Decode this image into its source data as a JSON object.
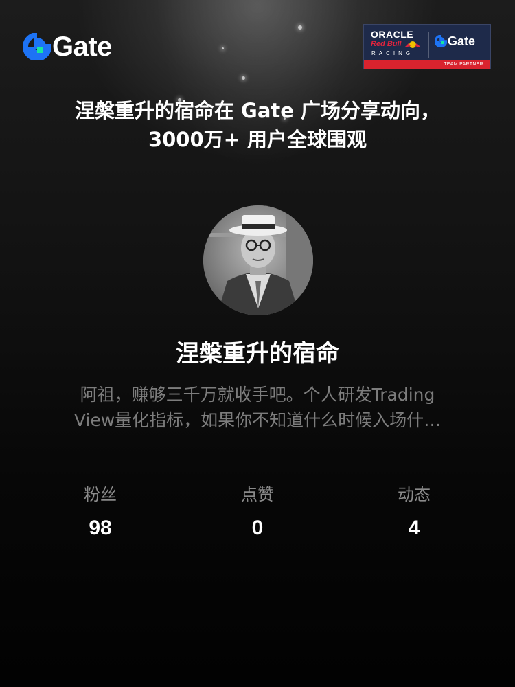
{
  "brand": {
    "name": "Gate",
    "accent_blue": "#1d73f5",
    "accent_green": "#17e6a1"
  },
  "partner_badge": {
    "line1": "ORACLE",
    "line2": "Red Bull",
    "line3": "RACING",
    "partner_name": "Gate",
    "footer": "TEAM PARTNER"
  },
  "headline": {
    "line1": "涅槃重升的宿命在 Gate 广场分享动向，",
    "line2": "3000万+ 用户全球围观"
  },
  "profile": {
    "name": "涅槃重升的宿命",
    "bio_line1": "阿祖，赚够三千万就收手吧。个人研发Trading",
    "bio_line2": "View量化指标，如果你不知道什么时候入场什…"
  },
  "stats": [
    {
      "label": "粉丝",
      "value": "98"
    },
    {
      "label": "点赞",
      "value": "0"
    },
    {
      "label": "动态",
      "value": "4"
    }
  ]
}
